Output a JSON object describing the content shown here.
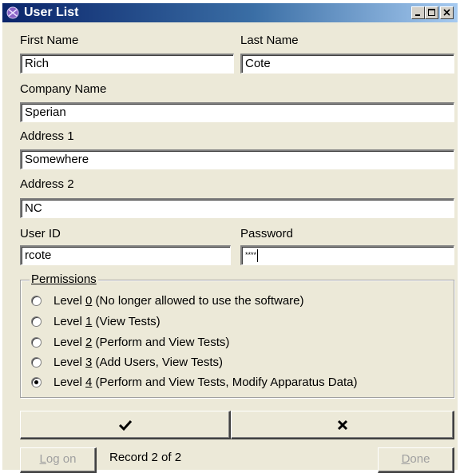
{
  "window": {
    "title": "User List",
    "title_gradient": [
      "#0a246a",
      "#3a6ea5",
      "#a6caf0"
    ],
    "face_color": "#ece9d8"
  },
  "titlebar_buttons": [
    {
      "name": "minimize-button",
      "icon": "minimize-icon"
    },
    {
      "name": "maximize-button",
      "icon": "maximize-icon"
    },
    {
      "name": "close-button",
      "icon": "close-icon"
    }
  ],
  "form": {
    "first_name": {
      "label": "First Name",
      "value": "Rich"
    },
    "last_name": {
      "label": "Last Name",
      "value": "Cote"
    },
    "company_name": {
      "label": "Company Name",
      "value": "Sperian"
    },
    "address1": {
      "label": "Address 1",
      "value": "Somewhere"
    },
    "address2": {
      "label": "Address 2",
      "value": "NC"
    },
    "user_id": {
      "label": "User ID",
      "value": "rcote"
    },
    "password": {
      "label": "Password",
      "value": "****"
    }
  },
  "permissions": {
    "legend": "Permissions",
    "selected_index": 4,
    "options": [
      {
        "prefix": "Level ",
        "key": "0",
        "suffix": " (No longer allowed to use the software)"
      },
      {
        "prefix": "Level ",
        "key": "1",
        "suffix": " (View Tests)"
      },
      {
        "prefix": "Level ",
        "key": "2",
        "suffix": " (Perform and View Tests)"
      },
      {
        "prefix": "Level ",
        "key": "3",
        "suffix": " (Add Users, View Tests)"
      },
      {
        "prefix": "Level ",
        "key": "4",
        "suffix": " (Perform and View Tests, Modify Apparatus Data)"
      }
    ]
  },
  "actions": {
    "accept_icon": "checkmark-icon",
    "cancel_icon": "x-icon"
  },
  "footer": {
    "logon_label_key": "L",
    "logon_label_rest": "og on",
    "record_text": "Record 2 of 2",
    "done_label_key": "D",
    "done_label_rest": "one"
  }
}
